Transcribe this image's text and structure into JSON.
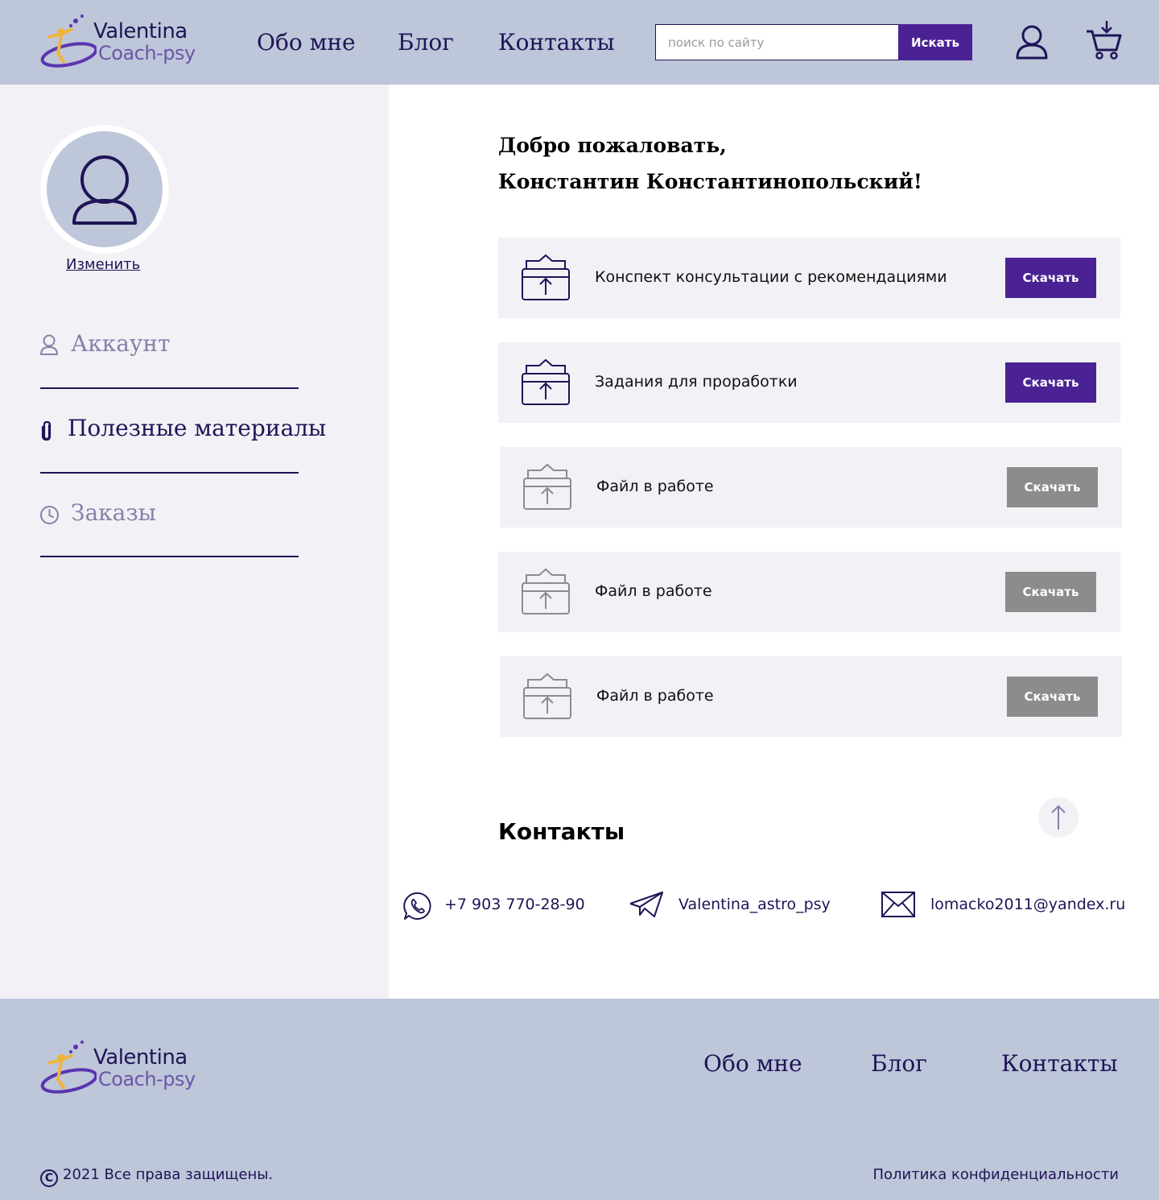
{
  "header": {
    "logo": {
      "name": "Valentina",
      "sub": "Coach-psy"
    },
    "nav": [
      {
        "label": "Обо мне"
      },
      {
        "label": "Блог"
      },
      {
        "label": "Контакты"
      }
    ],
    "search": {
      "placeholder": "поиск по сайту",
      "value": "",
      "button": "Искать"
    },
    "icons": {
      "account": "user-icon",
      "cart": "cart-icon"
    }
  },
  "sidebar": {
    "change_label": "Изменить",
    "items": [
      {
        "label": "Аккаунт",
        "icon": "user-icon",
        "active": false
      },
      {
        "label": "Полезные материалы",
        "icon": "paperclip-icon",
        "active": true
      },
      {
        "label": "Заказы",
        "icon": "clock-icon",
        "active": false
      }
    ]
  },
  "main": {
    "welcome_line1": "Добро пожаловать,",
    "welcome_line2": "Константин Константинопольский!",
    "files": [
      {
        "title": "Конспект консультации с рекомендациями",
        "button": "Скачать",
        "status": "available"
      },
      {
        "title": "Задания для проработки",
        "button": "Скачать",
        "status": "available"
      },
      {
        "title": "Файл в работе",
        "button": "Скачать",
        "status": "in-progress"
      },
      {
        "title": "Файл в работе",
        "button": "Скачать",
        "status": "in-progress"
      },
      {
        "title": "Файл в работе",
        "button": "Скачать",
        "status": "in-progress"
      }
    ],
    "contacts": {
      "title": "Контакты",
      "phone": "+7 903 770-28-90",
      "telegram": "Valentina_astro_psy",
      "email": "lomacko2011@yandex.ru"
    }
  },
  "footer": {
    "logo": {
      "name": "Valentina",
      "sub": "Coach-psy"
    },
    "nav": [
      {
        "label": "Обо мне"
      },
      {
        "label": "Блог"
      },
      {
        "label": "Контакты"
      }
    ],
    "copyright_symbol": "C",
    "copyright": "2021  Все права защищены.",
    "privacy": "Политика конфиденциальности"
  },
  "colors": {
    "header_bg": "#bec6d9",
    "sidebar_bg": "#f1f1f6",
    "accent": "#4b2294",
    "text_dark": "#1f1457",
    "disabled": "#8c8c8c"
  }
}
